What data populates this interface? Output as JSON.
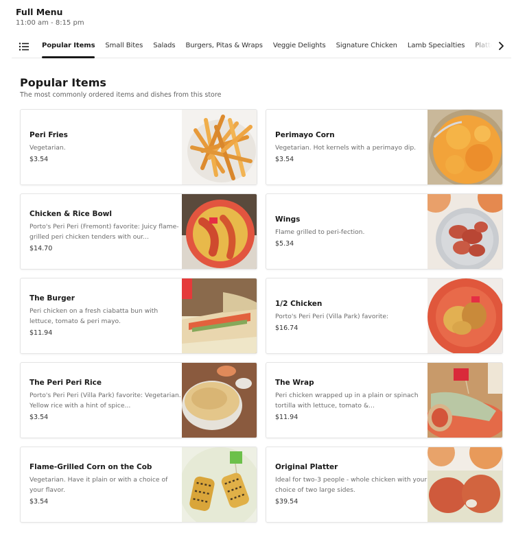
{
  "header": {
    "title": "Full Menu",
    "hours": "11:00 am - 8:15 pm"
  },
  "tabbar": {
    "menu_icon": "list-icon",
    "next_icon": "chevron-right-icon",
    "tabs": [
      {
        "label": "Popular Items",
        "active": true
      },
      {
        "label": "Small Bites",
        "active": false
      },
      {
        "label": "Salads",
        "active": false
      },
      {
        "label": "Burgers, Pitas & Wraps",
        "active": false
      },
      {
        "label": "Veggie Delights",
        "active": false
      },
      {
        "label": "Signature Chicken",
        "active": false
      },
      {
        "label": "Lamb Specialties",
        "active": false
      },
      {
        "label": "Platters",
        "active": false
      }
    ]
  },
  "section": {
    "title": "Popular Items",
    "subtitle": "The most commonly ordered items and dishes from this store"
  },
  "items": [
    {
      "name": "Peri Fries",
      "description": "Vegetarian.",
      "price": "$3.54",
      "image": "fries-photo"
    },
    {
      "name": "Perimayo Corn",
      "description": "Vegetarian. Hot kernels with a perimayo dip.",
      "price": "$3.54",
      "image": "corn-bowl-photo"
    },
    {
      "name": "Chicken & Rice Bowl",
      "description": "Porto's Peri Peri (Fremont) favorite: Juicy flame-grilled peri chicken tenders with our...",
      "price": "$14.70",
      "image": "chicken-rice-bowl-photo"
    },
    {
      "name": "Wings",
      "description": "Flame grilled to peri-fection.",
      "price": "$5.34",
      "image": "wings-photo"
    },
    {
      "name": "The Burger",
      "description": "Peri chicken on a fresh ciabatta bun with lettuce, tomato & peri mayo.",
      "price": "$11.94",
      "image": "burger-photo"
    },
    {
      "name": "1/2 Chicken",
      "description": "Porto's Peri Peri (Villa Park) favorite:",
      "price": "$16.74",
      "image": "half-chicken-photo"
    },
    {
      "name": "The Peri Peri Rice",
      "description": "Porto's Peri Peri (Villa Park) favorite: Vegetarian. Yellow rice with a hint of spice...",
      "price": "$3.54",
      "image": "rice-photo"
    },
    {
      "name": "The Wrap",
      "description": "Peri chicken wrapped up in a plain or spinach tortilla with lettuce, tomato &...",
      "price": "$11.94",
      "image": "wrap-photo"
    },
    {
      "name": "Flame-Grilled Corn on the Cob",
      "description": "Vegetarian. Have it plain or with a choice of your flavor.",
      "price": "$3.54",
      "image": "corn-cob-photo"
    },
    {
      "name": "Original Platter",
      "description": "Ideal for two-3 people - whole chicken with your choice of two large sides.",
      "price": "$39.54",
      "image": "platter-photo"
    }
  ]
}
